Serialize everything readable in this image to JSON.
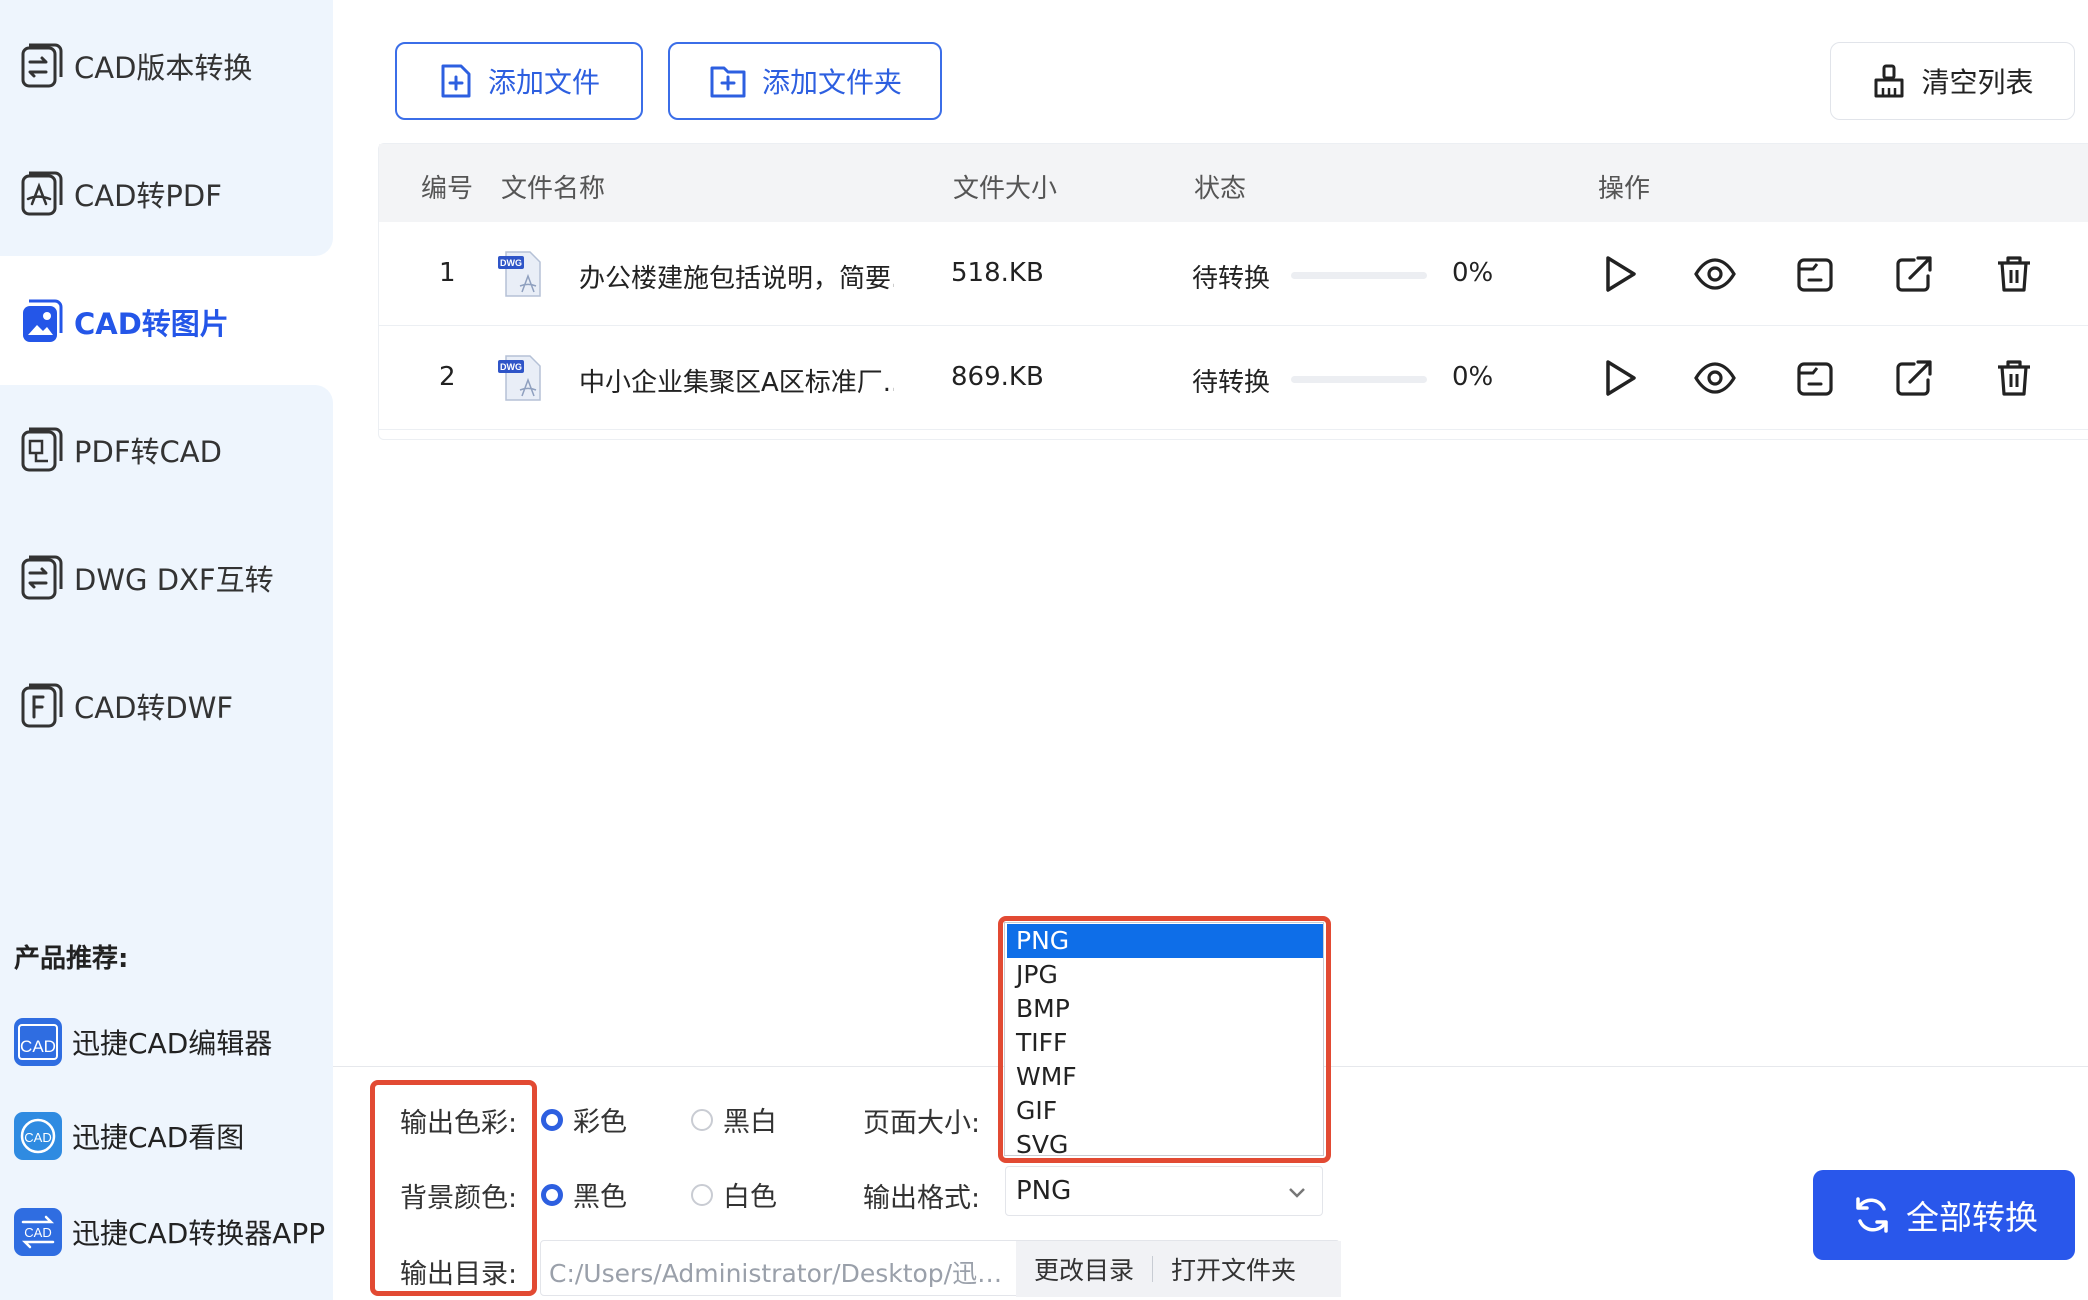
{
  "sidebar": {
    "items": [
      {
        "label": "CAD版本转换",
        "icon": "version-convert-icon"
      },
      {
        "label": "CAD转PDF",
        "icon": "pdf-convert-icon"
      },
      {
        "label": "CAD转图片",
        "icon": "image-convert-icon",
        "active": true
      },
      {
        "label": "PDF转CAD",
        "icon": "pdf-to-cad-icon"
      },
      {
        "label": "DWG DXF互转",
        "icon": "dwg-dxf-icon"
      },
      {
        "label": "CAD转DWF",
        "icon": "dwf-convert-icon"
      }
    ],
    "promo_title": "产品推荐:",
    "promo": [
      {
        "label": "迅捷CAD编辑器",
        "icon": "cad-editor-app-icon"
      },
      {
        "label": "迅捷CAD看图",
        "icon": "cad-viewer-app-icon"
      },
      {
        "label": "迅捷CAD转换器APP",
        "icon": "cad-converter-app-icon"
      }
    ]
  },
  "toolbar": {
    "add_file": "添加文件",
    "add_folder": "添加文件夹",
    "clear_list": "清空列表"
  },
  "table": {
    "headers": {
      "index": "编号",
      "name": "文件名称",
      "size": "文件大小",
      "status": "状态",
      "actions": "操作"
    },
    "rows": [
      {
        "index": "1",
        "file_badge": "DWG",
        "name": "办公楼建施包括说明，简要...",
        "size": "518.KB",
        "status": "待转换",
        "progress": 0,
        "percent": "0%"
      },
      {
        "index": "2",
        "file_badge": "DWG",
        "name": "中小企业集聚区A区标准厂...",
        "size": "869.KB",
        "status": "待转换",
        "progress": 0,
        "percent": "0%"
      }
    ]
  },
  "settings": {
    "color_label": "输出色彩:",
    "color_options": [
      "彩色",
      "黑白"
    ],
    "bg_label": "背景颜色:",
    "bg_options": [
      "黑色",
      "白色"
    ],
    "dir_label": "输出目录:",
    "page_size_label": "页面大小:",
    "format_label": "输出格式:",
    "format_value": "PNG",
    "dir_path": "C:/Users/Administrator/Desktop/迅捷...",
    "change_dir": "更改目录",
    "open_folder": "打开文件夹"
  },
  "format_dropdown": {
    "options": [
      "PNG",
      "JPG",
      "BMP",
      "TIFF",
      "WMF",
      "GIF",
      "SVG"
    ],
    "selected": "PNG"
  },
  "convert_all": "全部转换",
  "colors": {
    "accent": "#2957eb",
    "highlight": "#e24a33",
    "sidebar_bg": "#eef5fd",
    "selected_option": "#0e6ee8"
  }
}
